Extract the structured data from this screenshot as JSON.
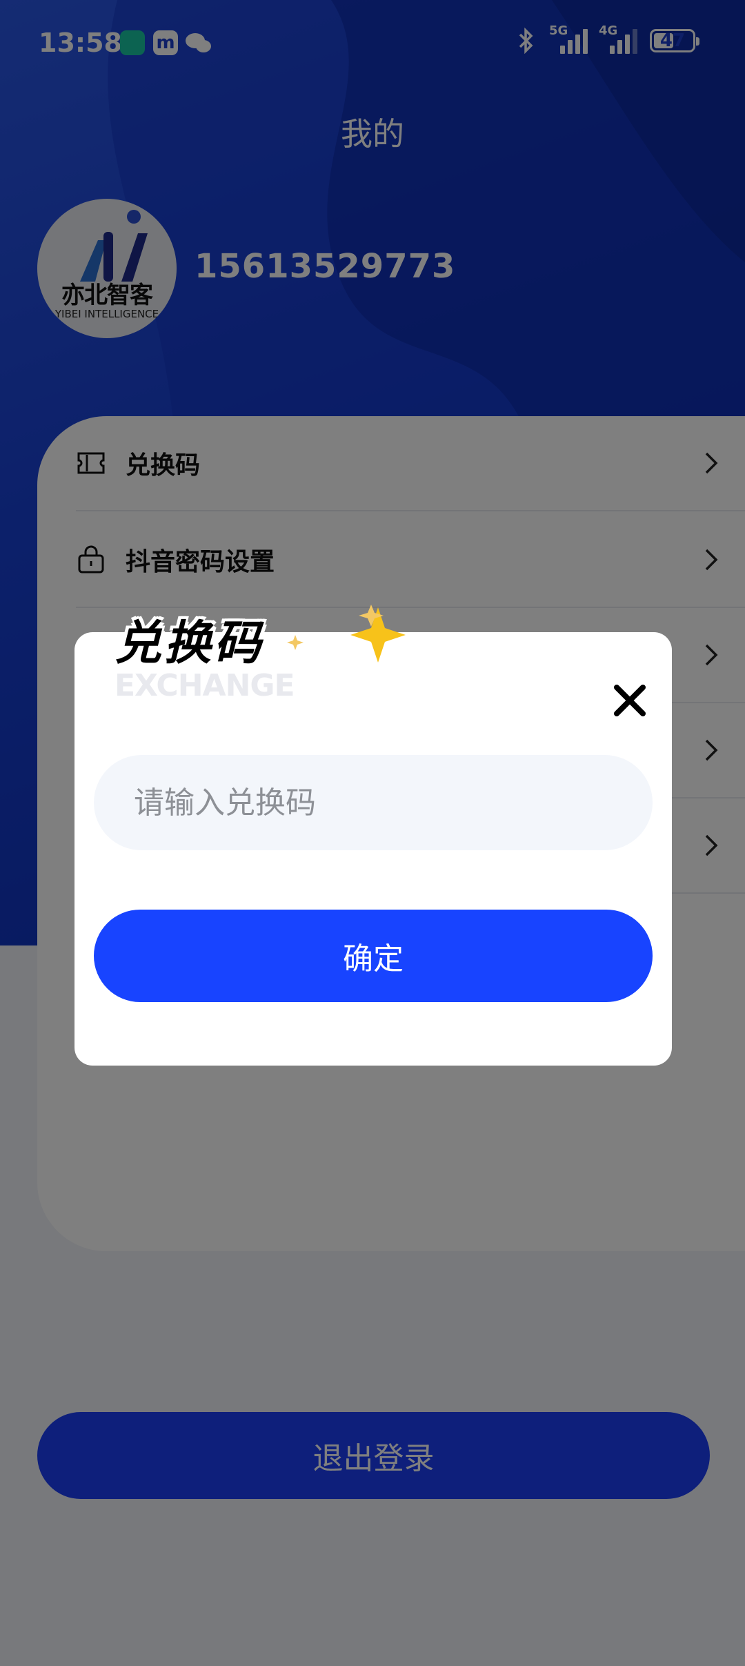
{
  "status_bar": {
    "time": "13:58",
    "signal1_label": "5G",
    "signal2_label": "4G",
    "battery": "47",
    "app_icons": [
      "mi-home-icon",
      "m-app-icon",
      "wechat-icon"
    ]
  },
  "header": {
    "title": "我的"
  },
  "profile": {
    "avatar_text": "亦北智客",
    "avatar_subtext": "YIBEI INTELLIGENCE",
    "phone": "15613529773"
  },
  "menu": {
    "items": [
      {
        "label": "兑换码",
        "icon": "ticket-icon"
      },
      {
        "label": "抖音密码设置",
        "icon": "lock-icon"
      },
      {
        "label": "",
        "icon": ""
      },
      {
        "label": "",
        "icon": ""
      },
      {
        "label": "",
        "icon": ""
      }
    ]
  },
  "logout_label": "退出登录",
  "modal": {
    "title": "兑换码",
    "subtitle": "EXCHANGE",
    "input_placeholder": "请输入兑换码",
    "confirm_label": "确定"
  },
  "colors": {
    "primary": "#1844ff",
    "hero": "#1840d4",
    "input_bg": "#f3f6fb"
  }
}
